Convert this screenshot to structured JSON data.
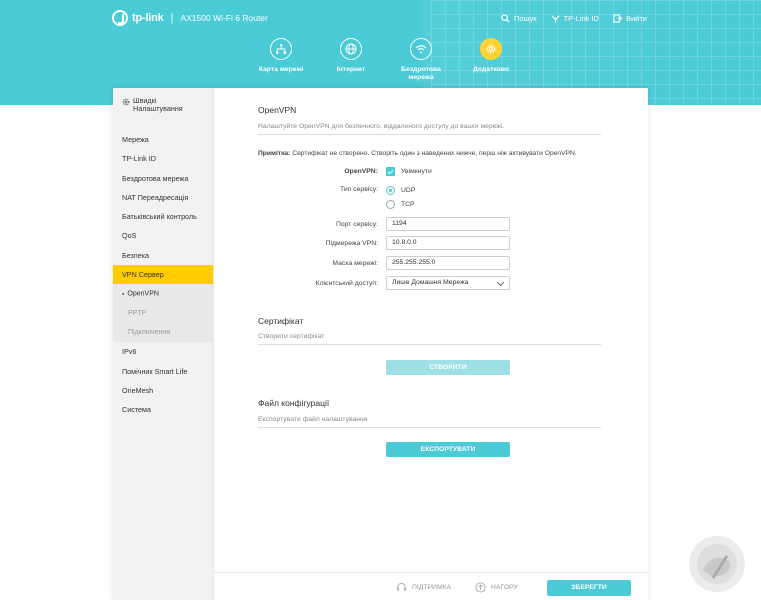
{
  "header": {
    "brand": "tp-link",
    "model": "AX1500 Wi-Fi 6 Router",
    "links": {
      "search": "Пошук",
      "tplink_id": "TP-Link ID",
      "logout": "Вийти"
    }
  },
  "nav": {
    "items": [
      {
        "label": "Карта мережі",
        "icon": "network-map-icon"
      },
      {
        "label": "Інтернет",
        "icon": "globe-icon"
      },
      {
        "label": "Бездротова мережа",
        "icon": "wifi-icon"
      },
      {
        "label": "Додатково",
        "icon": "gear-icon",
        "active": true
      }
    ],
    "accent_color": "#ffd233"
  },
  "sidebar": {
    "quick_setup": "Швидкі Налаштування",
    "items": [
      "Мережа",
      "TP-Link ID",
      "Бездротова мережа",
      "NAT Переадресація",
      "Батьківський контроль",
      "QoS",
      "Безпека",
      "VPN Сервер"
    ],
    "active_item": "VPN Сервер",
    "sub_items": [
      "OpenVPN",
      "PPTP",
      "Підключення"
    ],
    "after_items": [
      "IPv6",
      "Помічник Smart Life",
      "OneMesh",
      "Система"
    ]
  },
  "openvpn": {
    "title": "OpenVPN",
    "subtitle": "Налаштуйте OpenVPN для безпечного, віддаленого доступу до вашої мережі.",
    "note_label": "Примітка:",
    "note_text": "Сертифікат не створено. Створіть один з наведених нижче, перш ніж активувати OpenVPN.",
    "enable_label": "OpenVPN:",
    "enable_option": "Увімкнути",
    "enabled": true,
    "service_type_label": "Тип сервісу:",
    "service_types": [
      "UDP",
      "TCP"
    ],
    "service_type_selected": "UDP",
    "port_label": "Порт сервісу:",
    "port_value": "1194",
    "subnet_label": "Підмережа VPN:",
    "subnet_value": "10.8.0.0",
    "mask_label": "Маска мережі:",
    "mask_value": "255.255.255.0",
    "client_access_label": "Клієнтський доступ:",
    "client_access_value": "Лише Домашня Мережа"
  },
  "certificate": {
    "title": "Сертифікат",
    "subtitle": "Створити сертифікат",
    "button": "СТВОРИТИ"
  },
  "config_file": {
    "title": "Файл конфігурації",
    "subtitle": "Експортувати файл налаштування",
    "button": "ЕКСПОРТУВАТИ"
  },
  "footer": {
    "support": "ПІДТРИМКА",
    "top": "НАГОРУ",
    "save": "ЗБЕРЕГТИ"
  },
  "colors": {
    "brand": "#4acbd6",
    "active_highlight": "#ffcc00"
  }
}
